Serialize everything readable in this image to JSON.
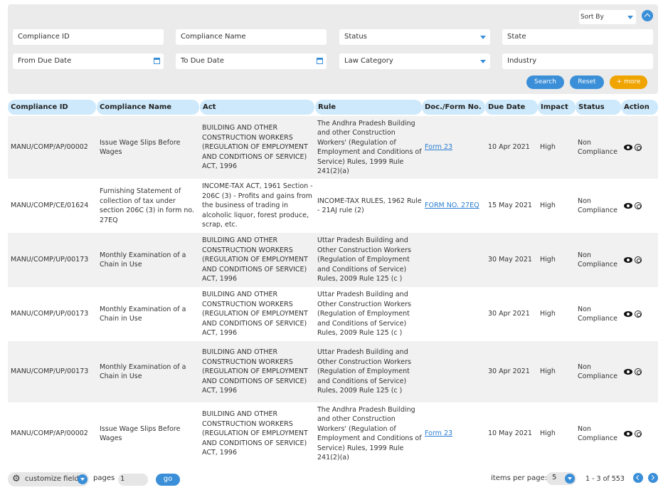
{
  "filters": {
    "sort_by": "Sort By",
    "compliance_id": "Compliance ID",
    "compliance_name": "Compliance Name",
    "status": "Status",
    "state": "State",
    "from_due_date": "From Due Date",
    "to_due_date": "To Due Date",
    "law_category": "Law Category",
    "industry": "Industry",
    "search_label": "Search",
    "reset_label": "Reset",
    "more_label": "+ more"
  },
  "table": {
    "headers": [
      "Compliance ID",
      "Compliance Name",
      "Act",
      "Rule",
      "Doc./Form No.",
      "Due Date",
      "Impact",
      "Status",
      "Action"
    ],
    "rows": [
      {
        "id": "MANU/COMP/AP/00002",
        "name": "Issue Wage Slips Before Wages",
        "act": "BUILDING AND OTHER CONSTRUCTION WORKERS (REGULATION OF EMPLOYMENT AND CONDITIONS OF SERVICE) ACT, 1996",
        "rule": "The Andhra Pradesh Building and other Construction Workers' (Regulation of Employment and Conditions of Service) Rules, 1999 Rule 241(2)(a)",
        "doc": "Form 23",
        "due": "10 Apr 2021",
        "impact": "High",
        "status": "Non Compliance"
      },
      {
        "id": "MANU/COMP/CE/01624",
        "name": "Furnishing Statement of collection of tax under section 206C (3) in form no. 27EQ",
        "act": "INCOME-TAX ACT, 1961 Section - 206C (3) - Profits and gains from the business of trading in alcoholic liquor, forest produce, scrap, etc.",
        "rule": "INCOME-TAX RULES, 1962 Rule - 21AJ rule (2)",
        "doc": "FORM NO. 27EQ",
        "due": "15 May 2021",
        "impact": "High",
        "status": "Non Compliance"
      },
      {
        "id": "MANU/COMP/UP/00173",
        "name": "Monthly Examination of a Chain in Use",
        "act": "BUILDING AND OTHER CONSTRUCTION WORKERS (REGULATION OF EMPLOYMENT AND CONDITIONS OF SERVICE) ACT, 1996",
        "rule": "Uttar Pradesh Building and Other Construction Workers (Regulation of Employment and Conditions of Service) Rules, 2009 Rule 125 (c )",
        "doc": "",
        "due": "30 May 2021",
        "impact": "High",
        "status": "Non Compliance"
      },
      {
        "id": "MANU/COMP/UP/00173",
        "name": "Monthly Examination of a Chain in Use",
        "act": "BUILDING AND OTHER CONSTRUCTION WORKERS (REGULATION OF EMPLOYMENT AND CONDITIONS OF SERVICE) ACT, 1996",
        "rule": "Uttar Pradesh Building and Other Construction Workers (Regulation of Employment and Conditions of Service) Rules, 2009 Rule 125 (c )",
        "doc": "",
        "due": "30 Apr 2021",
        "impact": "High",
        "status": "Non Compliance"
      },
      {
        "id": "MANU/COMP/UP/00173",
        "name": "Monthly Examination of a Chain in Use",
        "act": "BUILDING AND OTHER CONSTRUCTION WORKERS (REGULATION OF EMPLOYMENT AND CONDITIONS OF SERVICE) ACT, 1996",
        "rule": "Uttar Pradesh Building and Other Construction Workers (Regulation of Employment and Conditions of Service) Rules, 2009 Rule 125 (c )",
        "doc": "",
        "due": "30 Apr 2021",
        "impact": "High",
        "status": "Non Compliance"
      },
      {
        "id": "MANU/COMP/AP/00002",
        "name": "Issue Wage Slips Before Wages",
        "act": "BUILDING AND OTHER CONSTRUCTION WORKERS (REGULATION OF EMPLOYMENT AND CONDITIONS OF SERVICE) ACT, 1996",
        "rule": "The Andhra Pradesh Building and other Construction Workers' (Regulation of Employment and Conditions of Service) Rules, 1999 Rule 241(2)(a)",
        "doc": "Form 23",
        "due": "10 May 2021",
        "impact": "High",
        "status": "Non Compliance"
      }
    ]
  },
  "footer": {
    "customize_label": "customize field",
    "pages_label": "pages",
    "page_value": "1",
    "go_label": "go",
    "items_per_page_label": "items per page:",
    "items_per_page_value": "5",
    "range_text": "1 - 3 of 553"
  },
  "icons": {
    "gear": "⚙"
  },
  "colors": {
    "accent": "#3a8fd8",
    "more_button": "#f0a400",
    "header_bg": "#cde9fb",
    "link": "#2a7ed1"
  }
}
